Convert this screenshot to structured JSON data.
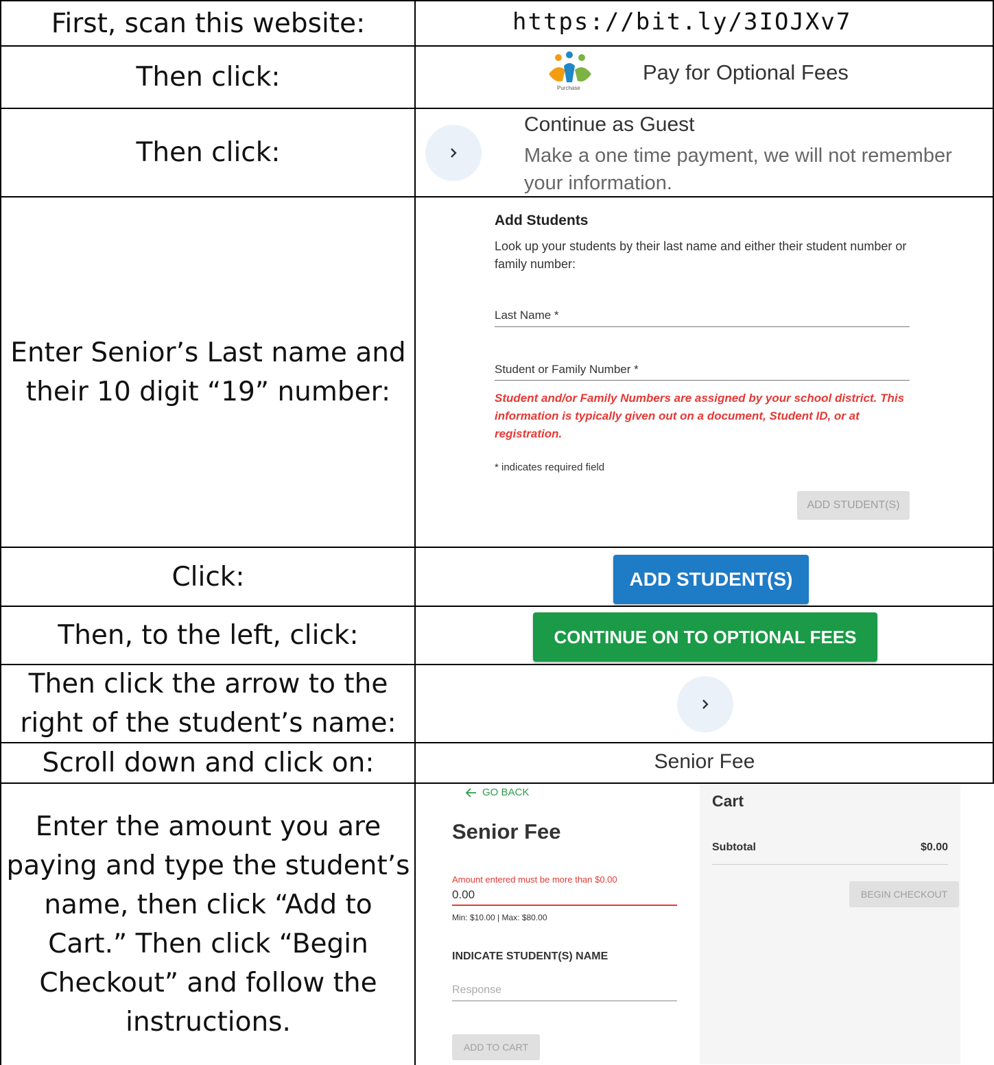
{
  "rows": [
    {
      "instruction": "First, scan this website:",
      "url": "https://bit.ly/3IOJXv7"
    },
    {
      "instruction": "Then click:",
      "link_text": "Pay for Optional Fees",
      "logo_caption": "Purchase"
    },
    {
      "instruction": "Then click:",
      "guest_title": "Continue as Guest",
      "guest_desc": "Make a one time payment, we will not remember your information."
    },
    {
      "instruction": "Enter Senior’s Last name and their 10 digit “19” number:",
      "form": {
        "title": "Add Students",
        "description": "Look up your students by their last name and either their student number or family number:",
        "last_name_label": "Last Name *",
        "number_label": "Student or Family Number *",
        "error": "Student and/or Family Numbers are assigned by your school district. This information is typically given out on a document, Student ID, or at registration.",
        "required_note": "* indicates required field",
        "button": "ADD STUDENT(S)"
      }
    },
    {
      "instruction": "Click:",
      "button": "ADD STUDENT(S)"
    },
    {
      "instruction": "Then, to the left, click:",
      "button": "CONTINUE ON TO OPTIONAL FEES"
    },
    {
      "instruction": "Then click the arrow to the right of the student’s name:"
    },
    {
      "instruction": "Scroll down and click on:",
      "item": "Senior Fee"
    },
    {
      "instruction": "Enter the amount you are paying and type the student’s name, then click “Add to Cart.” Then click “Begin Checkout” and follow the instructions.",
      "fee": {
        "go_back": "GO BACK",
        "title": "Senior Fee",
        "amount_error": "Amount entered must be more than $0.00",
        "amount_value": "0.00",
        "min_max": "Min: $10.00 | Max: $80.00",
        "name_label": "INDICATE STUDENT(S) NAME",
        "response_placeholder": "Response",
        "add_to_cart": "ADD TO CART"
      },
      "cart": {
        "title": "Cart",
        "subtotal_label": "Subtotal",
        "subtotal_value": "$0.00",
        "checkout": "BEGIN CHECKOUT"
      }
    }
  ],
  "colors": {
    "blue_button": "#1e7bc6",
    "green_button": "#1b9a47",
    "error_red": "#e53935",
    "circle_bg": "#eaf1f8"
  }
}
